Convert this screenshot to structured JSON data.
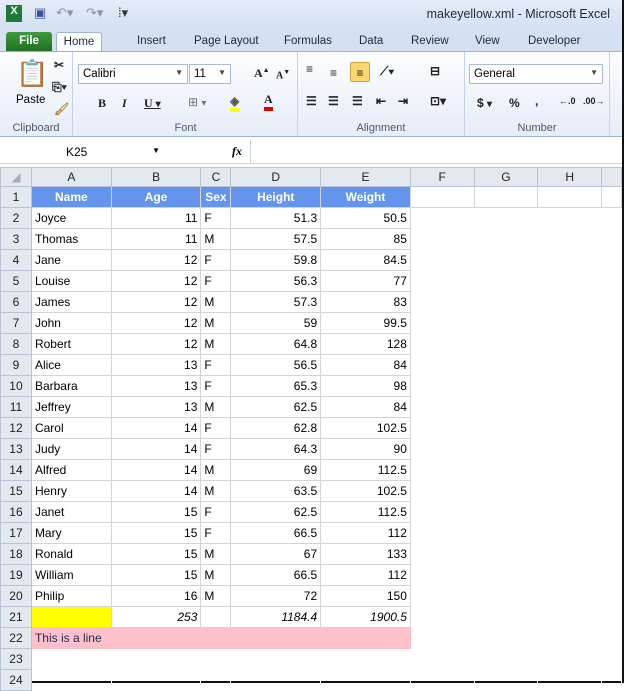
{
  "window": {
    "title": "makeyellow.xml  -  Microsoft Excel"
  },
  "ribbon": {
    "tabs": [
      "File",
      "Home",
      "Insert",
      "Page Layout",
      "Formulas",
      "Data",
      "Review",
      "View",
      "Developer"
    ],
    "clipboard": {
      "label": "Clipboard",
      "paste": "Paste"
    },
    "font": {
      "label": "Font",
      "name": "Calibri",
      "size": "11"
    },
    "alignment": {
      "label": "Alignment"
    },
    "number": {
      "label": "Number",
      "format": "General"
    }
  },
  "formula_bar": {
    "name_box": "K25",
    "fx": "fx",
    "value": ""
  },
  "sheet": {
    "columns": [
      "A",
      "B",
      "C",
      "D",
      "E",
      "F",
      "G",
      "H"
    ],
    "header": [
      "Name",
      "Age",
      "Sex",
      "Height",
      "Weight"
    ],
    "rows": [
      [
        "Joyce",
        "11",
        "F",
        "51.3",
        "50.5"
      ],
      [
        "Thomas",
        "11",
        "M",
        "57.5",
        "85"
      ],
      [
        "Jane",
        "12",
        "F",
        "59.8",
        "84.5"
      ],
      [
        "Louise",
        "12",
        "F",
        "56.3",
        "77"
      ],
      [
        "James",
        "12",
        "M",
        "57.3",
        "83"
      ],
      [
        "John",
        "12",
        "M",
        "59",
        "99.5"
      ],
      [
        "Robert",
        "12",
        "M",
        "64.8",
        "128"
      ],
      [
        "Alice",
        "13",
        "F",
        "56.5",
        "84"
      ],
      [
        "Barbara",
        "13",
        "F",
        "65.3",
        "98"
      ],
      [
        "Jeffrey",
        "13",
        "M",
        "62.5",
        "84"
      ],
      [
        "Carol",
        "14",
        "F",
        "62.8",
        "102.5"
      ],
      [
        "Judy",
        "14",
        "F",
        "64.3",
        "90"
      ],
      [
        "Alfred",
        "14",
        "M",
        "69",
        "112.5"
      ],
      [
        "Henry",
        "14",
        "M",
        "63.5",
        "102.5"
      ],
      [
        "Janet",
        "15",
        "F",
        "62.5",
        "112.5"
      ],
      [
        "Mary",
        "15",
        "F",
        "66.5",
        "112"
      ],
      [
        "Ronald",
        "15",
        "M",
        "67",
        "133"
      ],
      [
        "William",
        "15",
        "M",
        "66.5",
        "112"
      ],
      [
        "Philip",
        "16",
        "M",
        "72",
        "150"
      ]
    ],
    "totals": {
      "age": "253",
      "height": "1184.4",
      "weight": "1900.5"
    },
    "line_text": "This is a line",
    "colors": {
      "header": "#6495ed",
      "yellow": "#ffff00",
      "pink": "#ffc0cb"
    }
  }
}
